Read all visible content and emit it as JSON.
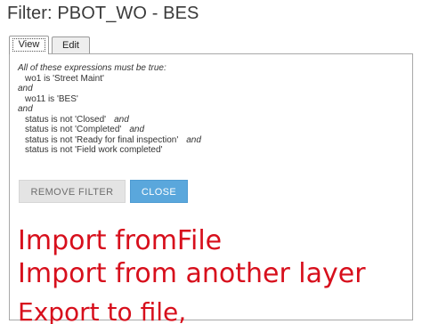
{
  "dialog": {
    "title": "Filter: PBOT_WO - BES"
  },
  "tabs": {
    "view": "View",
    "edit": "Edit"
  },
  "filter": {
    "intro": "All of these expressions must be true:",
    "clause_1": "wo1 is 'Street Maint'",
    "op_1": "and",
    "clause_2": "wo11 is 'BES'",
    "op_2": "and",
    "status_1": "status is not 'Closed'",
    "status_2": "status is not 'Completed'",
    "status_3": "status is not 'Ready for final inspection'",
    "status_4": "status is not 'Field work completed'",
    "inline_and": "and"
  },
  "buttons": {
    "remove": "REMOVE FILTER",
    "close": "CLOSE"
  },
  "annotations": {
    "color": "#d70f1c",
    "line_1": "Import fromFile",
    "line_2": "Import from another layer",
    "line_3": "Export to file,"
  }
}
